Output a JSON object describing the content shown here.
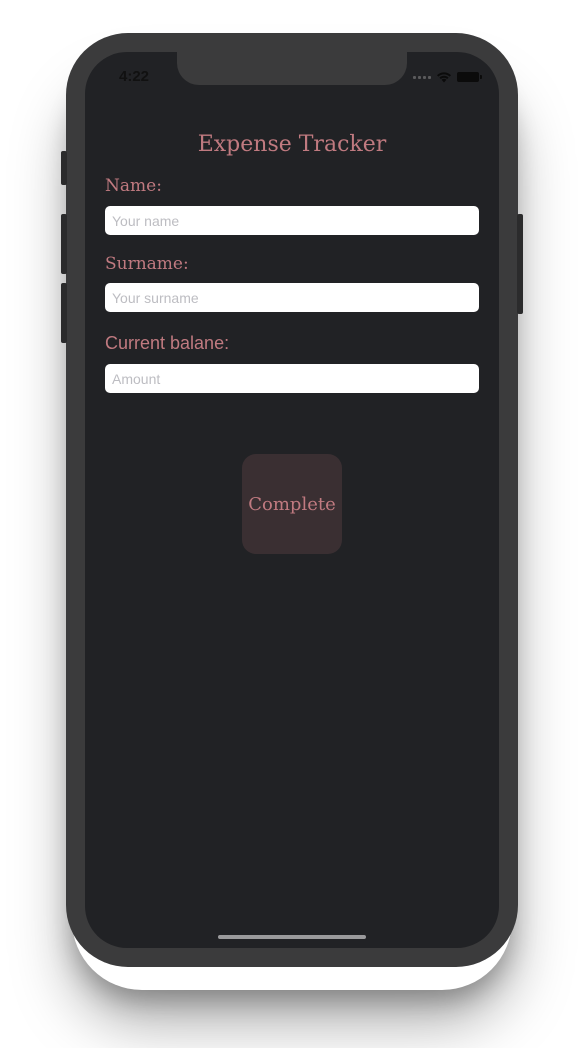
{
  "status_bar": {
    "time": "4:22",
    "icons": [
      "signal-icon",
      "wifi-icon",
      "battery-icon"
    ]
  },
  "app": {
    "title": "Expense Tracker"
  },
  "form": {
    "name": {
      "label": "Name:",
      "placeholder": "Your name",
      "value": ""
    },
    "surname": {
      "label": "Surname:",
      "placeholder": "Your surname",
      "value": ""
    },
    "balance": {
      "label": "Current balane:",
      "placeholder": "Amount",
      "value": ""
    },
    "submit_label": "Complete"
  },
  "colors": {
    "screen_bg": "#212225",
    "accent_text": "#c07a80",
    "button_bg": "#3a2f32",
    "device_frame": "#3b3b3c"
  }
}
